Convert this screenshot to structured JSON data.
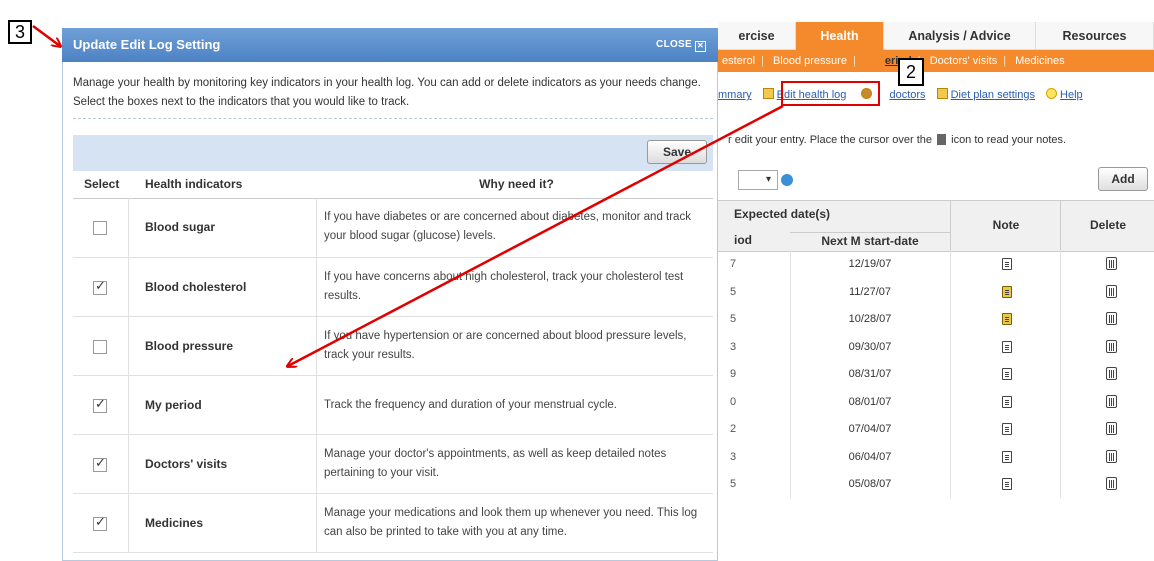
{
  "annotations": {
    "label_3": "3",
    "label_2": "2"
  },
  "colors": {
    "accent_orange": "#f58a2c",
    "modal_header": "#5a8fcf",
    "annotation_red": "#e10000"
  },
  "background_page": {
    "tabs": [
      {
        "label": "ercise",
        "active": false
      },
      {
        "label": "Health",
        "active": true
      },
      {
        "label": "Analysis / Advice",
        "active": false
      },
      {
        "label": "Resources",
        "active": false
      }
    ],
    "subnav": [
      "esterol",
      "Blood pressure",
      "eriod",
      "Doctors' visits",
      "Medicines"
    ],
    "links": {
      "summary": "mmary",
      "edit_health_log": "Edit health log",
      "my_doctors": "doctors",
      "diet_plan_settings": "Diet plan settings",
      "help": "Help"
    },
    "instruction_prefix": "r edit your entry. Place the cursor over the",
    "instruction_suffix": "icon to read your notes.",
    "add_label": "Add",
    "grid": {
      "expected_dates": "Expected date(s)",
      "iod": "iod",
      "next_start": "Next M start-date",
      "note": "Note",
      "delete": "Delete",
      "rows": [
        {
          "frag": "7",
          "date": "12/19/07",
          "note_icon": "note-icon"
        },
        {
          "frag": "5",
          "date": "11/27/07",
          "note_icon": "note-icon-highlighted"
        },
        {
          "frag": "5",
          "date": "10/28/07",
          "note_icon": "note-icon-highlighted"
        },
        {
          "frag": "3",
          "date": "09/30/07",
          "note_icon": "note-icon"
        },
        {
          "frag": "9",
          "date": "08/31/07",
          "note_icon": "note-icon"
        },
        {
          "frag": "0",
          "date": "08/01/07",
          "note_icon": "note-icon"
        },
        {
          "frag": "2",
          "date": "07/04/07",
          "note_icon": "note-icon"
        },
        {
          "frag": "3",
          "date": "06/04/07",
          "note_icon": "note-icon"
        },
        {
          "frag": "5",
          "date": "05/08/07",
          "note_icon": "note-icon"
        }
      ]
    }
  },
  "modal": {
    "title": "Update Edit Log Setting",
    "close_label": "CLOSE",
    "description": "Manage your health by monitoring key indicators in your health log. You can add or delete indicators as your needs change. Select the boxes next to the indicators that you would like to track.",
    "save_label": "Save",
    "columns": {
      "select": "Select",
      "indicator": "Health indicators",
      "why": "Why need it?"
    },
    "indicators": [
      {
        "name": "Blood sugar",
        "checked": false,
        "why": "If you have diabetes or are concerned about diabetes, monitor and track your blood sugar (glucose) levels."
      },
      {
        "name": "Blood cholesterol",
        "checked": true,
        "why": "If you have concerns about high cholesterol, track your cholesterol test results."
      },
      {
        "name": "Blood pressure",
        "checked": false,
        "why": "If you have hypertension or are concerned about blood pressure levels, track your results."
      },
      {
        "name": "My period",
        "checked": true,
        "why": "Track the frequency and duration of your menstrual cycle."
      },
      {
        "name": "Doctors' visits",
        "checked": true,
        "why": "Manage your doctor's appointments, as well as keep detailed notes pertaining to your visit."
      },
      {
        "name": "Medicines",
        "checked": true,
        "why": "Manage your medications and look them up whenever you need. This log can also be printed to take with you at any time."
      }
    ]
  }
}
